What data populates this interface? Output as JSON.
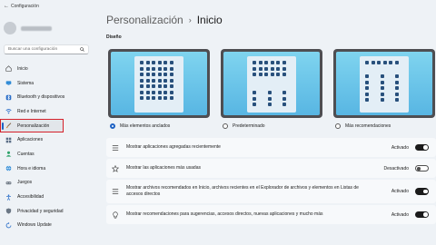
{
  "window": {
    "title": "Configuración"
  },
  "search": {
    "placeholder": "Buscar una configuración"
  },
  "nav": {
    "items": [
      {
        "label": "Inicio",
        "icon": "home-icon"
      },
      {
        "label": "Sistema",
        "icon": "monitor-icon"
      },
      {
        "label": "Bluetooth y dispositivos",
        "icon": "bluetooth-icon"
      },
      {
        "label": "Red e Internet",
        "icon": "network-icon"
      },
      {
        "label": "Personalización",
        "icon": "brush-icon",
        "selected": true
      },
      {
        "label": "Aplicaciones",
        "icon": "apps-icon"
      },
      {
        "label": "Cuentas",
        "icon": "account-icon"
      },
      {
        "label": "Hora e idioma",
        "icon": "globe-icon"
      },
      {
        "label": "Juegos",
        "icon": "gamepad-icon"
      },
      {
        "label": "Accesibilidad",
        "icon": "accessibility-icon"
      },
      {
        "label": "Privacidad y seguridad",
        "icon": "shield-icon"
      },
      {
        "label": "Windows Update",
        "icon": "update-icon"
      }
    ]
  },
  "breadcrumb": {
    "parent": "Personalización",
    "separator": "›",
    "current": "Inicio"
  },
  "design": {
    "label": "Diseño",
    "options": [
      {
        "label": "Más elementos anclados",
        "selected": true
      },
      {
        "label": "Predeterminado",
        "selected": false
      },
      {
        "label": "Más recomendaciones",
        "selected": false
      }
    ]
  },
  "settings": [
    {
      "label": "Mostrar aplicaciones agregadas recientemente",
      "state": "Activado",
      "on": true,
      "icon": "list-icon"
    },
    {
      "label": "Mostrar las aplicaciones más usadas",
      "state": "Desactivado",
      "on": false,
      "icon": "star-icon"
    },
    {
      "label": "Mostrar archivos recomendados en Inicio, archivos recientes en el Explorador de archivos y elementos en Listas de accesos directos",
      "state": "Activado",
      "on": true,
      "icon": "list-icon"
    },
    {
      "label": "Mostrar recomendaciones para sugerencias, accesos directos, nuevas aplicaciones y mucho más",
      "state": "Activado",
      "on": true,
      "icon": "lightbulb-icon"
    }
  ],
  "colors": {
    "accent": "#1e62c4",
    "highlight_outline": "#d4202a",
    "toggle_on": "#1b1b1b"
  }
}
